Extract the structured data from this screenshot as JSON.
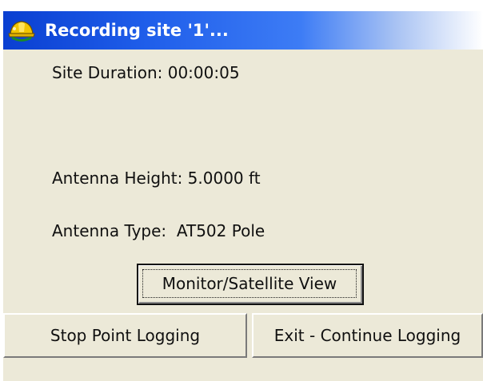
{
  "window": {
    "title": "Recording site '1'...",
    "app_icon": "hardhat-satellite-icon"
  },
  "info": {
    "site_duration": "Site Duration: 00:00:05",
    "antenna_height": "Antenna Height: 5.0000 ft",
    "antenna_type": "Antenna Type:  AT502 Pole"
  },
  "buttons": {
    "monitor": "Monitor/Satellite View",
    "stop": "Stop Point Logging",
    "exit": "Exit - Continue Logging"
  },
  "colors": {
    "title_bar_start": "#0a3fd1",
    "title_bar_end": "#ffffff",
    "dialog_background": "#ece9d8"
  }
}
